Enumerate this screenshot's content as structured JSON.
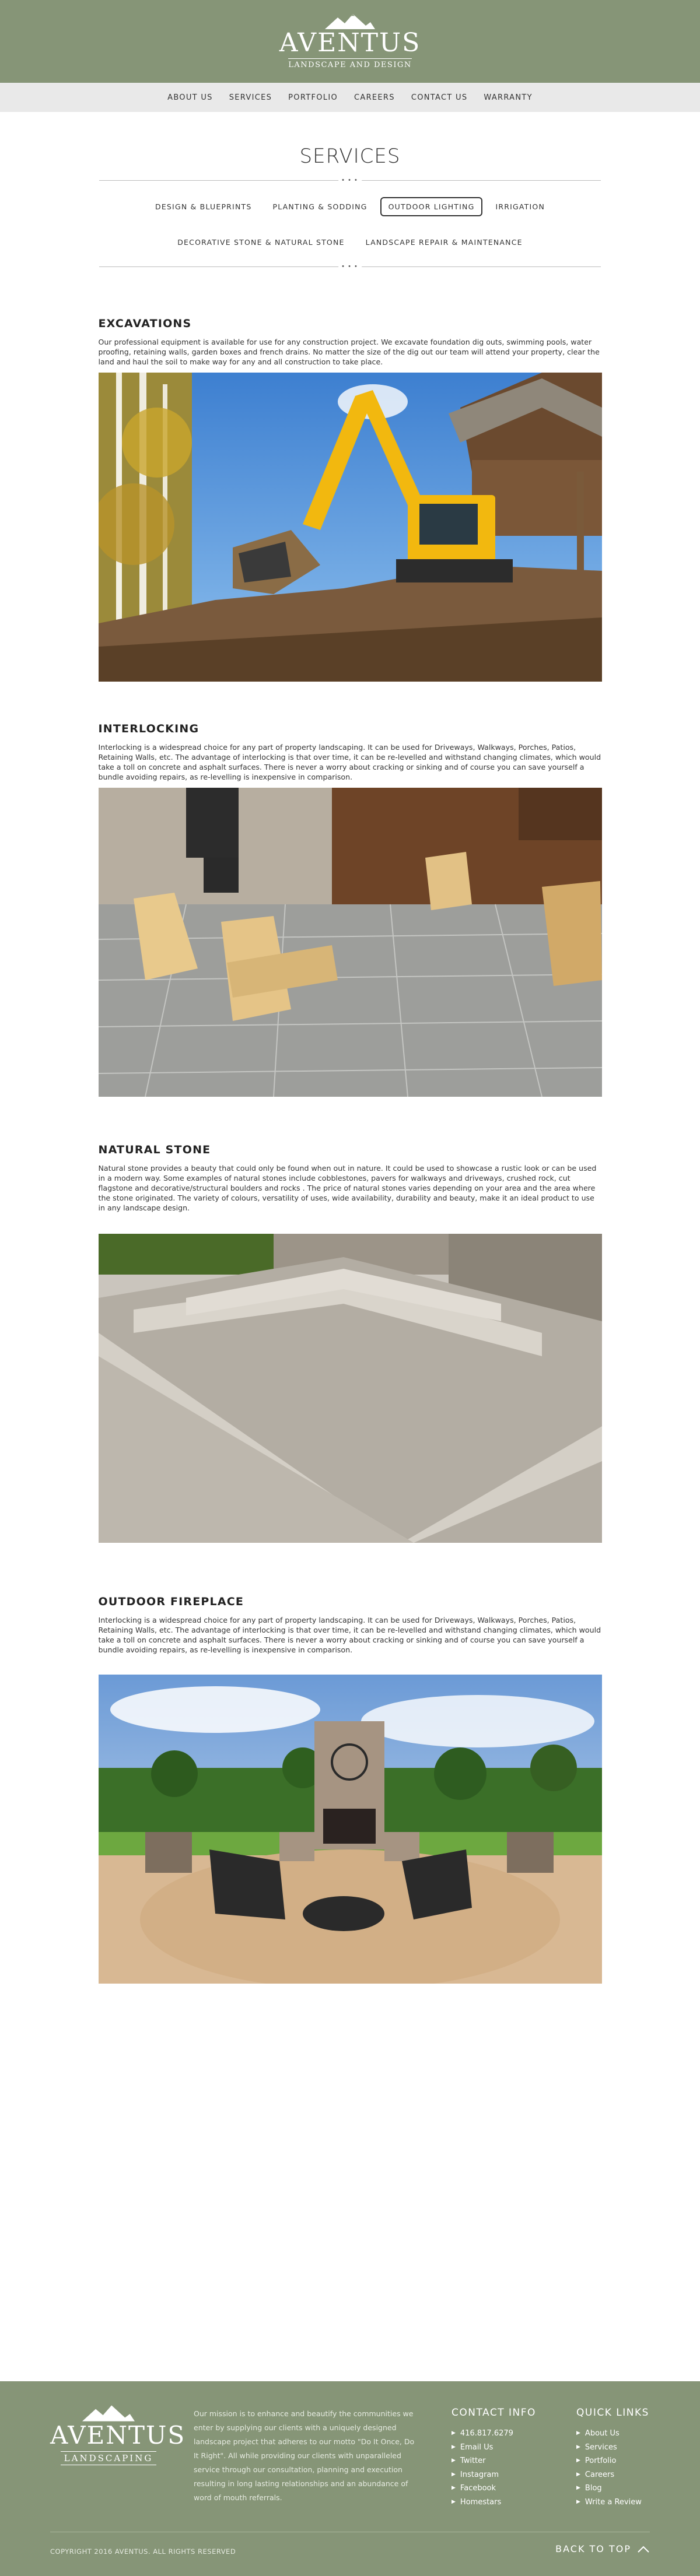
{
  "brand": {
    "name": "AVENTUS",
    "tagline": "LANDSCAPE AND DESIGN"
  },
  "nav": [
    "ABOUT US",
    "SERVICES",
    "PORTFOLIO",
    "CAREERS",
    "CONTACT US",
    "WARRANTY"
  ],
  "page": {
    "title": "SERVICES",
    "dots": "• • •",
    "filters_row1": [
      "DESIGN & BLUEPRINTS",
      "PLANTING & SODDING",
      "OUTDOOR LIGHTING",
      "IRRIGATION"
    ],
    "filters_row2": [
      "DECORATIVE STONE & NATURAL STONE",
      "LANDSCAPE REPAIR & MAINTENANCE"
    ],
    "active_filter": "OUTDOOR LIGHTING"
  },
  "sections": [
    {
      "title": "EXCAVATIONS",
      "text": "Our professional equipment is available for use for any construction project. We excavate foundation dig outs, swimming pools, water proofing, retaining walls, garden boxes and french drains. No matter the size of the dig out our team will attend your property, clear the land and haul the soil to make way for any and all construction to take place.",
      "image_icon": "excavator-photo"
    },
    {
      "title": "INTERLOCKING",
      "text": "Interlocking is a widespread choice for any part of property landscaping. It can be used for Driveways, Walkways, Porches, Patios, Retaining Walls, etc. The advantage of interlocking is that over time, it can be re-levelled and withstand changing climates, which would take a toll on concrete and asphalt surfaces. There is never a worry about cracking or sinking and of course you can save yourself a bundle avoiding repairs, as re-levelling is inexpensive in comparison.",
      "image_icon": "patio-chairs-photo"
    },
    {
      "title": "NATURAL STONE",
      "text": "Natural stone provides a beauty that could only be found when out in nature. It could be used to showcase a rustic look or can be used in a modern way. Some examples of natural stones include cobblestones, pavers for walkways and driveways, crushed rock, cut flagstone and decorative/structural boulders and rocks . The price of natural stones varies depending on your area and the area where the stone originated. The variety of colours, versatility of uses, wide availability, durability and beauty, make it an ideal product to use in any landscape design.",
      "image_icon": "stone-steps-photo"
    },
    {
      "title": "OUTDOOR FIREPLACE",
      "text": "Interlocking is a widespread choice for any part of property landscaping. It can be used for Driveways, Walkways, Porches, Patios, Retaining Walls, etc. The advantage of interlocking is that over time, it can be re-levelled and withstand changing climates, which would take a toll on concrete and asphalt surfaces. There is never a worry about cracking or sinking and of course you can save yourself a bundle avoiding repairs, as re-levelling is inexpensive in comparison.",
      "image_icon": "outdoor-fireplace-photo"
    }
  ],
  "footer": {
    "brand": "AVENTUS",
    "tagline": "LANDSCAPING",
    "mission": "Our mission is to enhance and beautify the communities we enter by supplying our clients with a uniquely designed landscape project that adheres to our motto \"Do It Once, Do It Right\". All while providing our clients with unparalleled service through our consultation, planning and execution resulting in long lasting relationships and an abundance of word of mouth referrals.",
    "contact_title": "CONTACT INFO",
    "contact": [
      "416.817.6279",
      "Email Us",
      "Twitter",
      "Instagram",
      "Facebook",
      "Homestars"
    ],
    "links_title": "QUICK LINKS",
    "links": [
      "About Us",
      "Services",
      "Portfolio",
      "Careers",
      "Blog",
      "Write a Review"
    ],
    "copyright": "COPYRIGHT 2016 AVENTUS. ALL RIGHTS RESERVED",
    "back_to_top": "BACK TO TOP"
  },
  "colors": {
    "header_green": "#869577",
    "nav_gray": "#e9e9e9",
    "text": "#333333"
  }
}
